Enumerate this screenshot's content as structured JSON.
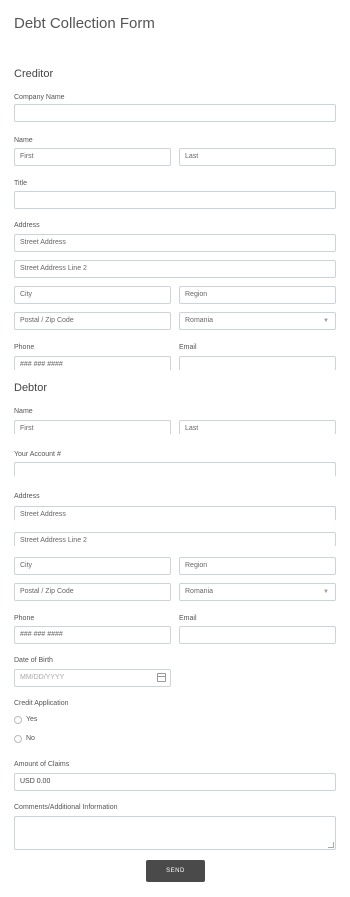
{
  "title": "Debt Collection Form",
  "creditor": {
    "heading": "Creditor",
    "company_label": "Company Name",
    "name_label": "Name",
    "first": "First",
    "last": "Last",
    "title_label": "Title",
    "address_label": "Address",
    "street": "Street Address",
    "street2": "Street Address Line 2",
    "city": "City",
    "region": "Region",
    "postal": "Postal / Zip Code",
    "country": "Romania",
    "phone_label": "Phone",
    "email_label": "Email",
    "phone_placeholder": "### ### ####"
  },
  "debtor": {
    "heading": "Debtor",
    "name_label": "Name",
    "first": "First",
    "last": "Last",
    "account_label": "Your Account #",
    "address_label": "Address",
    "street": "Street Address",
    "street2": "Street Address Line 2",
    "city": "City",
    "region": "Region",
    "postal": "Postal / Zip Code",
    "country": "Romania",
    "phone_label": "Phone",
    "email_label": "Email",
    "phone_placeholder": "### ### ####",
    "dob_label": "Date of Birth",
    "dob_placeholder": "MM/DD/YYYY",
    "credit_label": "Credit Application",
    "yes": "Yes",
    "no": "No",
    "amount_label": "Amount of Claims",
    "amount_value": "USD  0.00",
    "comments_label": "Comments/Additional Information"
  },
  "send_label": "SEND",
  "icons": {
    "dropdown": "chevron-down-icon",
    "calendar": "calendar-icon"
  }
}
